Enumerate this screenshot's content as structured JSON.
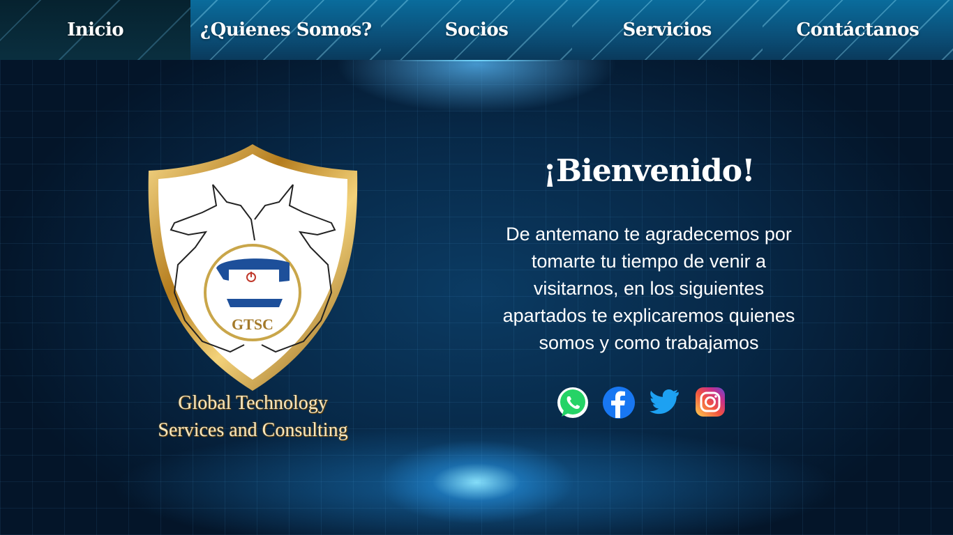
{
  "nav": {
    "items": [
      {
        "label": "Inicio"
      },
      {
        "label": "¿Quienes Somos?"
      },
      {
        "label": "Socios"
      },
      {
        "label": "Servicios"
      },
      {
        "label": "Contáctanos"
      }
    ]
  },
  "logo": {
    "badge_text": "GTSC",
    "line1": "Global Technology",
    "line2": "Services and Consulting"
  },
  "welcome": {
    "title": "¡Bienvenido!",
    "body_lines": [
      "De antemano te agradecemos por",
      "tomarte tu tiempo de venir a",
      "visitarnos, en los siguientes",
      "apartados te explicaremos quienes",
      "somos y como trabajamos"
    ]
  },
  "social": {
    "icons": [
      "whatsapp-icon",
      "facebook-icon",
      "twitter-icon",
      "instagram-icon"
    ]
  },
  "colors": {
    "nav_blue": "#0b5f8c",
    "gold": "#c9962e",
    "background": "#072847",
    "text": "#ffffff"
  }
}
